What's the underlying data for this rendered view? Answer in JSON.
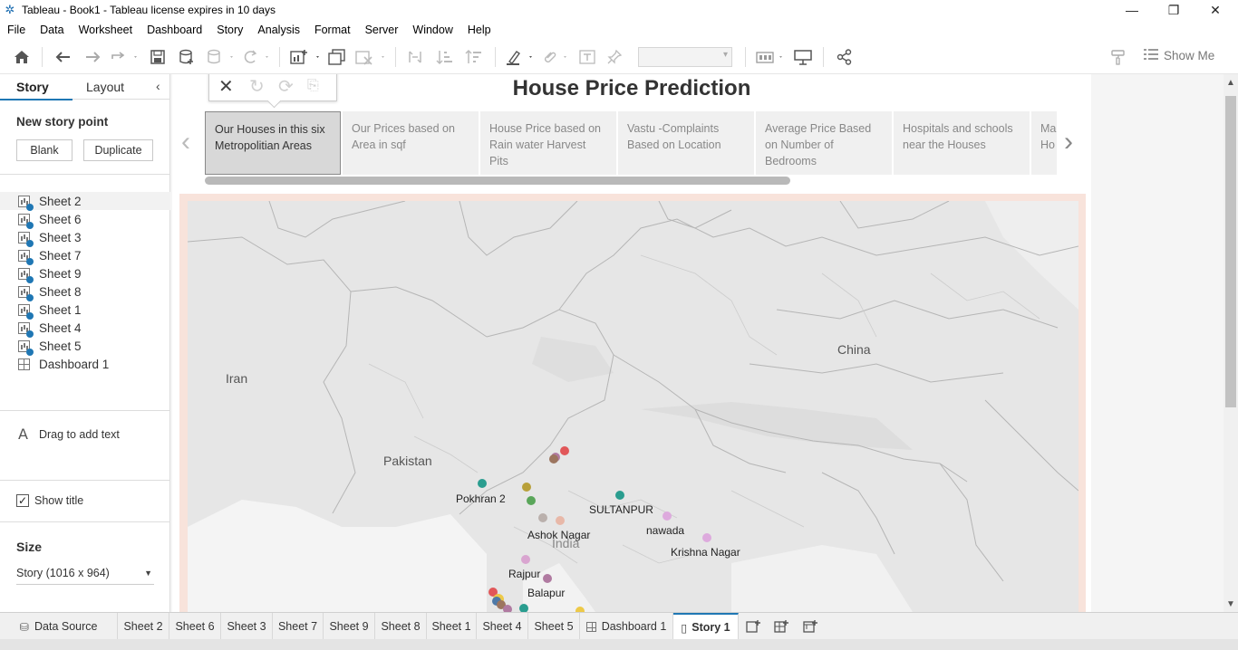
{
  "window": {
    "title": "Tableau - Book1 - Tableau license expires in 10 days",
    "minimize": "—",
    "restore": "❐",
    "close": "✕"
  },
  "menu": [
    "File",
    "Data",
    "Worksheet",
    "Dashboard",
    "Story",
    "Analysis",
    "Format",
    "Server",
    "Window",
    "Help"
  ],
  "toolbar": {
    "show_me": "Show Me"
  },
  "pane": {
    "tab_story": "Story",
    "tab_layout": "Layout",
    "collapse": "‹",
    "new_story_point": "New story point",
    "blank": "Blank",
    "duplicate": "Duplicate",
    "sheets": [
      "Sheet 2",
      "Sheet 6",
      "Sheet 3",
      "Sheet 7",
      "Sheet 9",
      "Sheet 8",
      "Sheet 1",
      "Sheet 4",
      "Sheet 5"
    ],
    "dashboard": "Dashboard 1",
    "drag_text": "Drag to add text",
    "drag_icon": "A",
    "show_title": "Show title",
    "show_title_checked": "✓",
    "size_label": "Size",
    "size_value": "Story (1016 x 964)"
  },
  "story": {
    "title": "House Price Prediction",
    "points": [
      "Our Houses in this six Metropolitian Areas",
      "Our Prices based on Area in sqf",
      "House Price based on Rain water Harvest Pits",
      "Vastu -Complaints Based on Location",
      "Average Price Based on Number of Bedrooms",
      "Hospitals and schools near the Houses",
      "Ma Ho"
    ],
    "nav_prev": "‹",
    "nav_next": "›"
  },
  "map": {
    "countries": [
      "Iran",
      "Pakistan",
      "China",
      "India"
    ],
    "cities": [
      "Pokhran 2",
      "SULTANPUR",
      "Ashok Nagar",
      "nawada",
      "Krishna Nagar",
      "Rajpur",
      "Balapur"
    ],
    "point_colors": [
      "#e15759",
      "#b07aa1",
      "#4e79a7",
      "#f28e2b",
      "#76b7b2",
      "#59a14f",
      "#edc948",
      "#ff9da7",
      "#9c755f",
      "#bab0ac",
      "#d37295",
      "#2a9d8f",
      "#b8a03a",
      "#5aa65a"
    ]
  },
  "tabs": {
    "data_source": "Data Source",
    "sheets": [
      "Sheet 2",
      "Sheet 6",
      "Sheet 3",
      "Sheet 7",
      "Sheet 9",
      "Sheet 8",
      "Sheet 1",
      "Sheet 4",
      "Sheet 5"
    ],
    "dashboard": "Dashboard 1",
    "story": "Story 1"
  }
}
